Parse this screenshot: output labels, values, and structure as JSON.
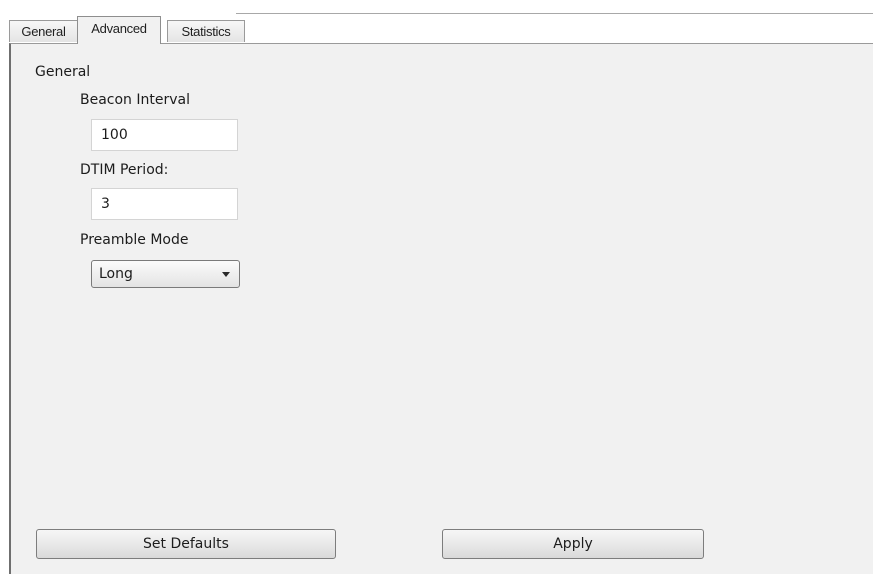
{
  "tabs": [
    {
      "label": "General",
      "active": false
    },
    {
      "label": "Advanced",
      "active": true
    },
    {
      "label": "Statistics",
      "active": false
    }
  ],
  "panel": {
    "section_title": "General",
    "beacon_interval": {
      "label": "Beacon Interval",
      "value": "100"
    },
    "dtim_period": {
      "label": "DTIM Period:",
      "value": "3"
    },
    "preamble_mode": {
      "label": "Preamble Mode",
      "selected": "Long"
    }
  },
  "buttons": {
    "set_defaults": "Set Defaults",
    "apply": "Apply"
  },
  "colors": {
    "panel_background": "#f1f1f1",
    "input_background": "#ffffff"
  }
}
